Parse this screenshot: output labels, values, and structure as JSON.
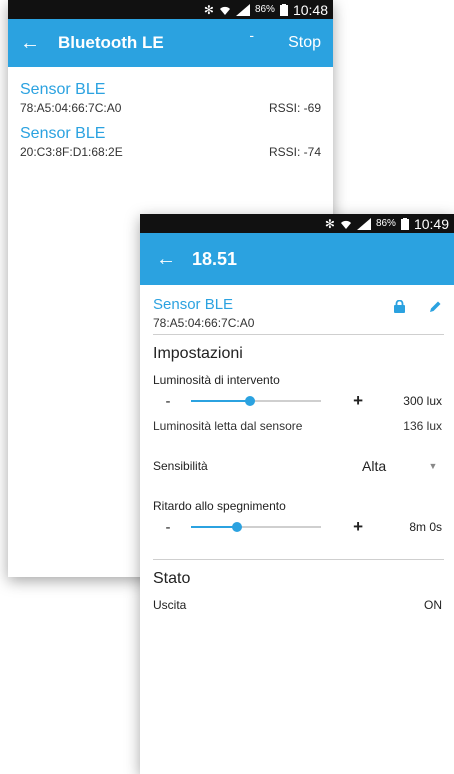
{
  "back_screen": {
    "status": {
      "battery": "86%",
      "time": "10:48"
    },
    "appbar": {
      "back_icon": "←",
      "title": "Bluetooth LE",
      "dash": "-",
      "stop_label": "Stop"
    },
    "devices": [
      {
        "name": "Sensor BLE",
        "mac": "78:A5:04:66:7C:A0",
        "rssi": "RSSI: -69"
      },
      {
        "name": "Sensor BLE",
        "mac": "20:C3:8F:D1:68:2E",
        "rssi": "RSSI: -74"
      }
    ]
  },
  "front_screen": {
    "status": {
      "battery": "86%",
      "time": "10:49"
    },
    "appbar": {
      "back_icon": "←",
      "title": "18.51"
    },
    "device": {
      "name": "Sensor BLE",
      "mac": "78:A5:04:66:7C:A0",
      "lock_icon": "lock-icon",
      "edit_icon": "pencil-icon"
    },
    "settings": {
      "title": "Impostazioni",
      "luminosity": {
        "label": "Luminosità di intervento",
        "minus": "-",
        "plus": "+",
        "value": "300  lux",
        "level": 0.45
      },
      "read": {
        "label": "Luminosità letta dal sensore",
        "value": "136  lux"
      },
      "sensitivity": {
        "label": "Sensibilità",
        "value": "Alta"
      },
      "delay": {
        "label": "Ritardo allo spegnimento",
        "minus": "-",
        "plus": "+",
        "value": "8m 0s",
        "level": 0.35
      }
    },
    "state": {
      "title": "Stato",
      "output_label": "Uscita",
      "output_value": "ON"
    },
    "accent_color": "#2ba2e0"
  }
}
